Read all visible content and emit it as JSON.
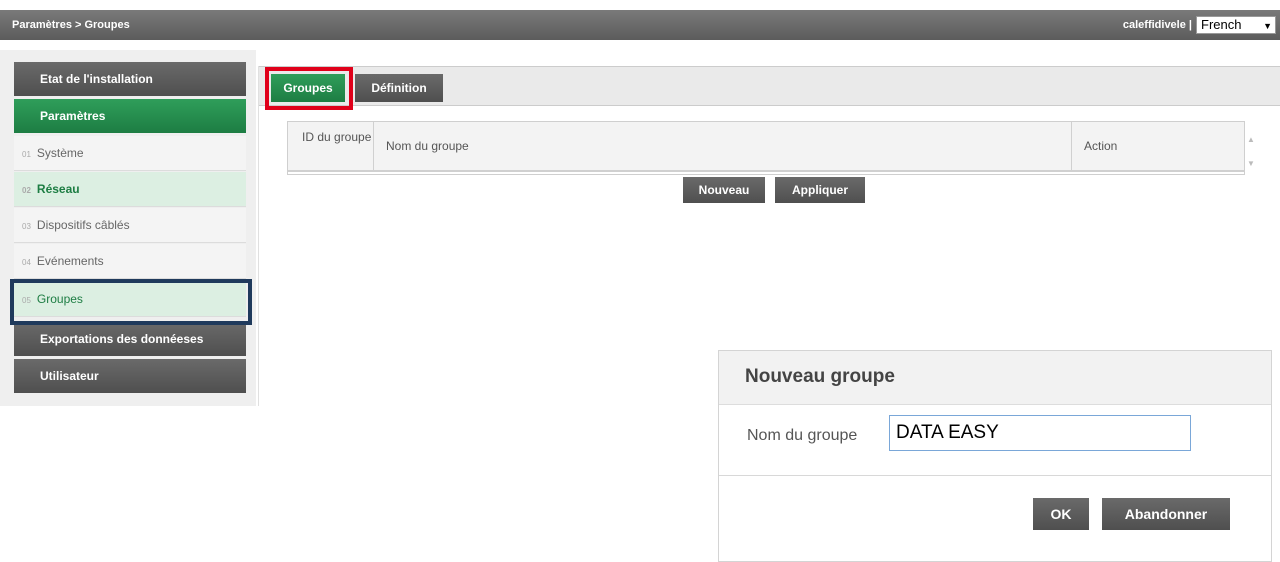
{
  "header": {
    "breadcrumb": "Paramètres > Groupes",
    "user": "caleffidivele |",
    "language": "French"
  },
  "sidebar": {
    "main_buttons": [
      {
        "label": "Etat de l'installation"
      },
      {
        "label": "Paramètres"
      },
      {
        "label": "Exportations des donnéeses"
      },
      {
        "label": "Utilisateur"
      }
    ],
    "items": [
      {
        "num": "01",
        "label": "Système"
      },
      {
        "num": "02",
        "label": "Réseau"
      },
      {
        "num": "03",
        "label": "Dispositifs câblés"
      },
      {
        "num": "04",
        "label": "Evénements"
      },
      {
        "num": "05",
        "label": "Groupes"
      }
    ]
  },
  "tabs": [
    {
      "label": "Groupes"
    },
    {
      "label": "Définition"
    }
  ],
  "table": {
    "columns": [
      "ID du groupe",
      "Nom du groupe",
      "Action"
    ]
  },
  "buttons": {
    "new": "Nouveau",
    "apply": "Appliquer"
  },
  "dialog": {
    "title": "Nouveau groupe",
    "field_label": "Nom du groupe",
    "field_value": "DATA EASY",
    "ok": "OK",
    "cancel": "Abandonner"
  },
  "colors": {
    "green": "#1d7d43",
    "dark_gray": "#4f4f4f",
    "highlight_red": "#e0001a",
    "highlight_blue": "#1f3a5c"
  }
}
